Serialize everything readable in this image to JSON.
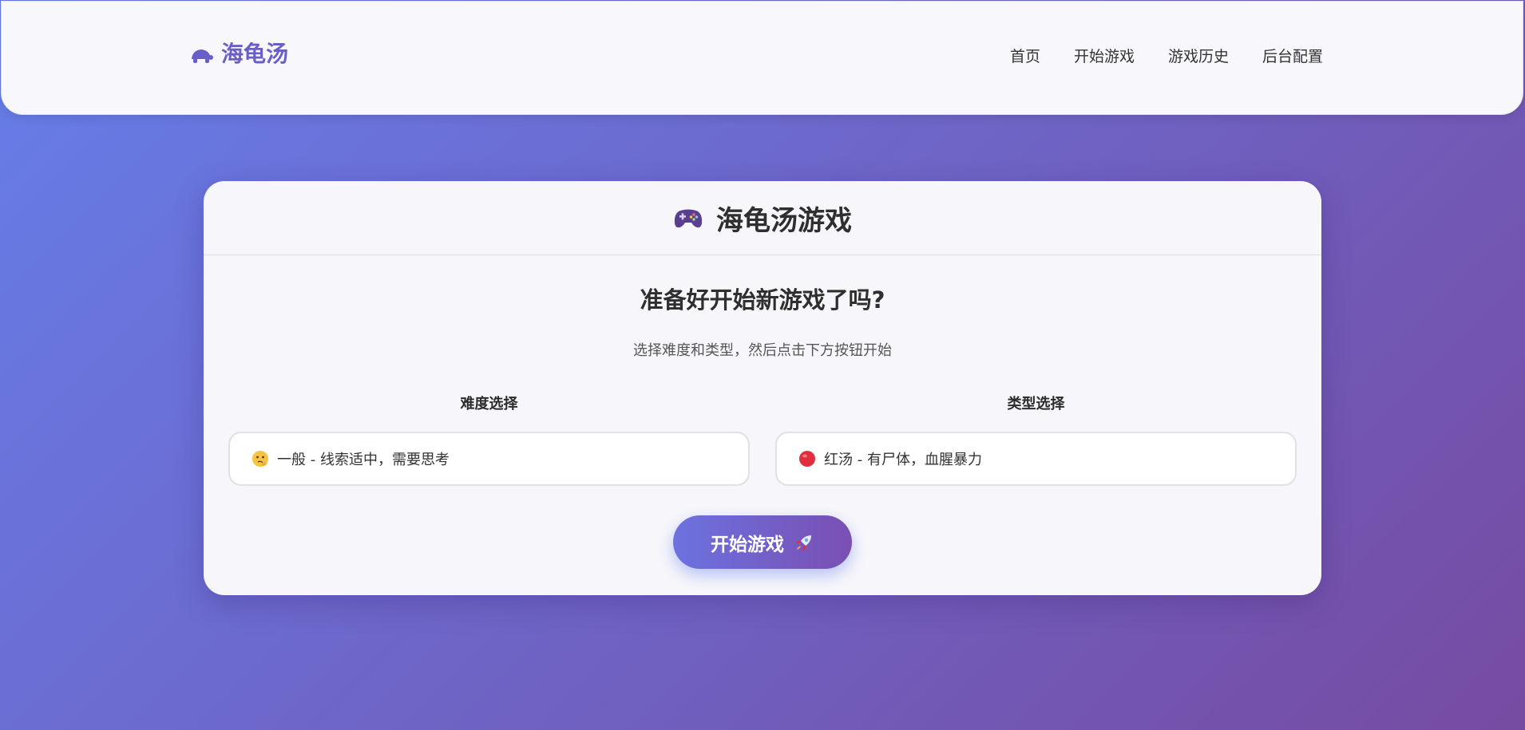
{
  "navbar": {
    "brand": {
      "icon": "turtle-icon",
      "text": "海龟汤"
    },
    "links": [
      {
        "label": "首页"
      },
      {
        "label": "开始游戏"
      },
      {
        "label": "游戏历史"
      },
      {
        "label": "后台配置"
      }
    ]
  },
  "card": {
    "header": {
      "icon": "gamepad-icon",
      "title": "海龟汤游戏"
    },
    "heading": "准备好开始新游戏了吗?",
    "subtitle": "选择难度和类型，然后点击下方按钮开始",
    "difficulty": {
      "label": "难度选择",
      "selected": "一般 - 线索适中，需要思考",
      "icon": "thinking-face-icon"
    },
    "type": {
      "label": "类型选择",
      "selected": "红汤 - 有尸体，血腥暴力",
      "icon": "red-circle-icon"
    },
    "start_button": {
      "label": "开始游戏",
      "icon": "rocket-icon"
    }
  },
  "colors": {
    "brand": "#6a5fc9",
    "gradient_start": "#667eea",
    "gradient_end": "#764ba2"
  }
}
